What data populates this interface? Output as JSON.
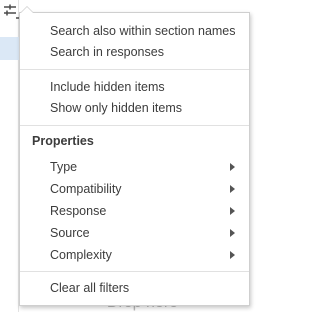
{
  "background": {
    "drop_hint_text": "Drop here"
  },
  "menu": {
    "section1": [
      {
        "label": "Search also within section names"
      },
      {
        "label": "Search in responses"
      }
    ],
    "section2": [
      {
        "label": "Include hidden items"
      },
      {
        "label": "Show only hidden items"
      }
    ],
    "properties_heading": "Properties",
    "properties": [
      {
        "label": "Type",
        "has_submenu": true
      },
      {
        "label": "Compatibility",
        "has_submenu": true
      },
      {
        "label": "Response",
        "has_submenu": true
      },
      {
        "label": "Source",
        "has_submenu": true
      },
      {
        "label": "Complexity",
        "has_submenu": true
      }
    ],
    "clear_label": "Clear all filters"
  },
  "colors": {
    "selected_row": "#dbe8f6",
    "menu_border": "#cfcfcf",
    "text": "#3c3c3c"
  }
}
